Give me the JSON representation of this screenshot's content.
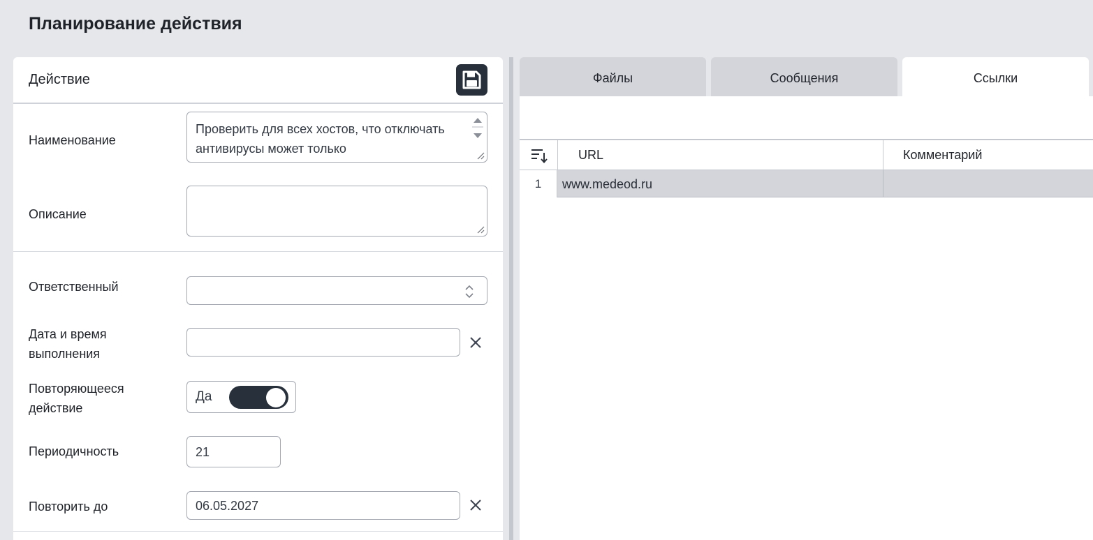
{
  "page": {
    "title": "Планирование действия"
  },
  "action_panel": {
    "title": "Действие",
    "save_icon": "floppy-disk-icon",
    "fields": {
      "name": {
        "label": "Наименование",
        "value": "Проверить для всех хостов, что отключать антивирусы может только"
      },
      "description": {
        "label": "Описание",
        "value": ""
      },
      "responsible": {
        "label": "Ответственный",
        "value": ""
      },
      "datetime": {
        "label_line1": "Дата и время",
        "label_line2": "выполнения",
        "value": ""
      },
      "recurring": {
        "label_line1": "Повторяющееся",
        "label_line2": "действие",
        "toggle_text": "Да",
        "checked": true
      },
      "period": {
        "label": "Периодичность",
        "value": "21"
      },
      "repeat_until": {
        "label": "Повторить до",
        "value": "06.05.2027"
      }
    }
  },
  "tabs": [
    {
      "label": "Файлы",
      "active": false
    },
    {
      "label": "Сообщения",
      "active": false
    },
    {
      "label": "Ссылки",
      "active": true
    }
  ],
  "links_grid": {
    "columns": [
      "URL",
      "Комментарий"
    ],
    "rows": [
      {
        "num": "1",
        "url": "www.medeod.ru",
        "comment": ""
      }
    ]
  },
  "colors": {
    "background": "#e6e7eb",
    "dark_accent": "#27303b",
    "tab_inactive": "#d3d5db",
    "selected_row": "#d3d5db"
  }
}
